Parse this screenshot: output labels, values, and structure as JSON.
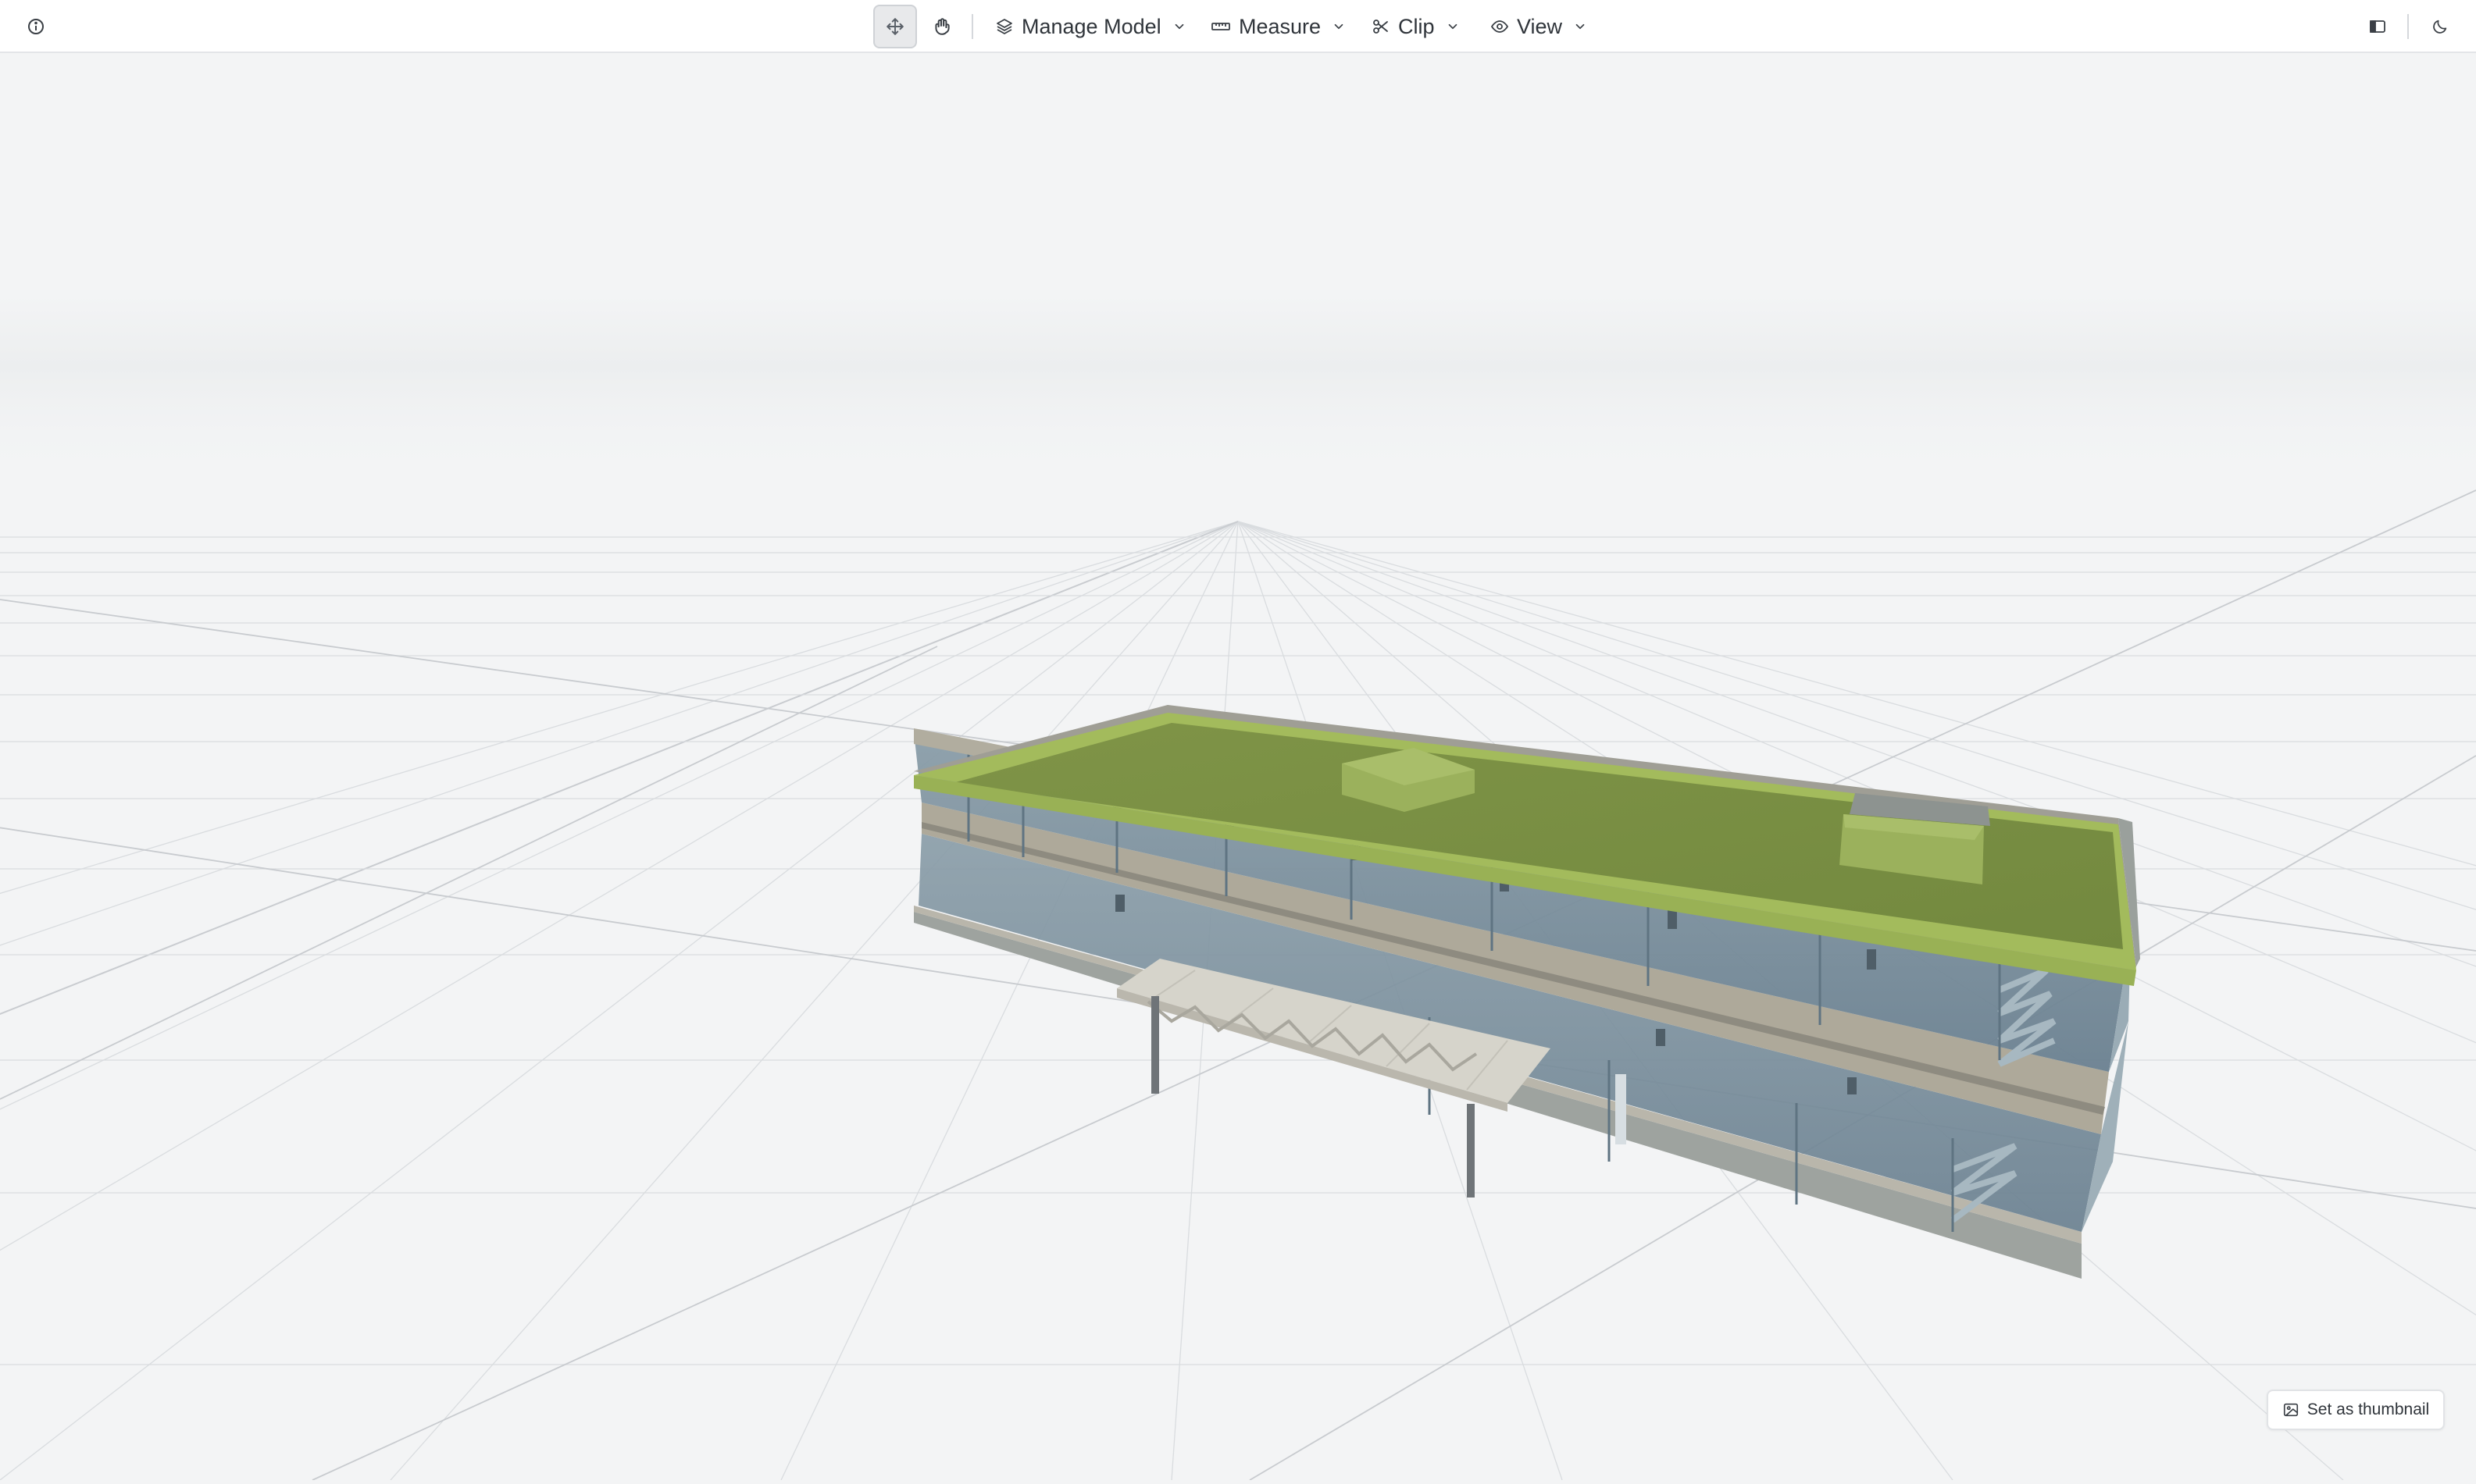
{
  "toolbar": {
    "info_icon": "info-circle-icon",
    "tools": [
      {
        "name": "orbit",
        "icon": "move-arrows-icon",
        "active": true
      },
      {
        "name": "pan",
        "icon": "hand-icon",
        "active": false
      }
    ],
    "menus": [
      {
        "label": "Manage Model",
        "icon": "layers-icon"
      },
      {
        "label": "Measure",
        "icon": "ruler-icon"
      },
      {
        "label": "Clip",
        "icon": "scissors-icon"
      },
      {
        "label": "View",
        "icon": "eye-icon"
      }
    ],
    "right": {
      "panel_icon": "sidebar-panel-icon",
      "theme_icon": "moon-icon"
    }
  },
  "viewport": {
    "scene": "3d-building-model",
    "roof_color": "#7a8f44",
    "roof_edge_color": "#a3bb5c",
    "glass_color": "#6f8592",
    "slab_color": "#aea99a",
    "background_color": "#f3f4f5"
  },
  "thumbnail": {
    "label": "Set as thumbnail",
    "icon": "image-icon"
  }
}
